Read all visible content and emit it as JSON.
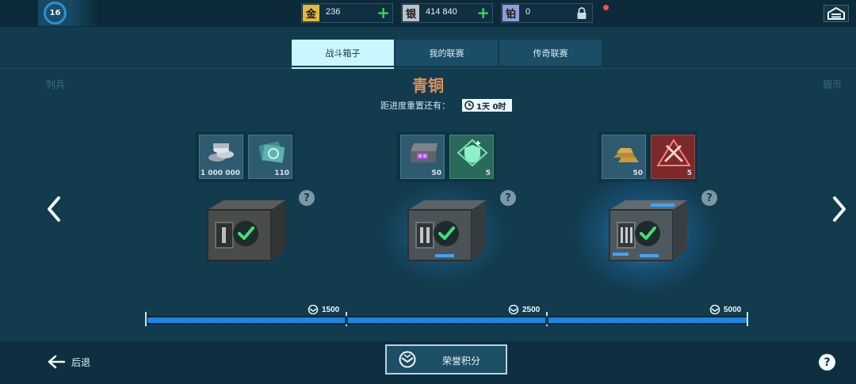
{
  "player": {
    "level": "16"
  },
  "currencies": [
    {
      "name": "gold",
      "glyph": "金",
      "value": "236",
      "icon_color": "#e3b93a"
    },
    {
      "name": "silver",
      "glyph": "银",
      "value": "414 840",
      "icon_color": "#b9c3c8"
    },
    {
      "name": "platinum",
      "glyph": "铂",
      "value": "0",
      "icon_color": "#8f9fd8"
    }
  ],
  "tabs": [
    {
      "label": "战斗箱子",
      "active": true
    },
    {
      "label": "我的联赛",
      "active": false
    },
    {
      "label": "传奇联赛",
      "active": false
    }
  ],
  "league": {
    "prev": "列兵",
    "current": "青铜",
    "next": "银币",
    "reset_label": "距进度重置还有：",
    "reset_time": "1天 0时"
  },
  "tiers": [
    {
      "rewards": [
        {
          "icon": "silver-coins-icon",
          "count": "1 000 000"
        },
        {
          "icon": "blueprint-cards-icon",
          "count": "110"
        }
      ],
      "chest": "chest-tier-1",
      "claimed": true,
      "threshold": "1500"
    },
    {
      "rewards": [
        {
          "icon": "open-crate-icon",
          "count": "50"
        },
        {
          "icon": "shield-upgrade-icon",
          "count": "5"
        }
      ],
      "chest": "chest-tier-2",
      "claimed": true,
      "threshold": "2500"
    },
    {
      "rewards": [
        {
          "icon": "gold-bars-icon",
          "count": "50"
        },
        {
          "icon": "attack-boost-icon",
          "count": "5"
        }
      ],
      "chest": "chest-tier-3",
      "claimed": true,
      "threshold": "5000"
    }
  ],
  "progress": {
    "fraction_filled": 1.0
  },
  "bottom": {
    "back_label": "后退",
    "honor_label": "荣誉积分"
  },
  "colors": {
    "league_bronze": "#e0915a",
    "progress_blue": "#1d86e0",
    "claimed_check": "#3fe07a"
  }
}
